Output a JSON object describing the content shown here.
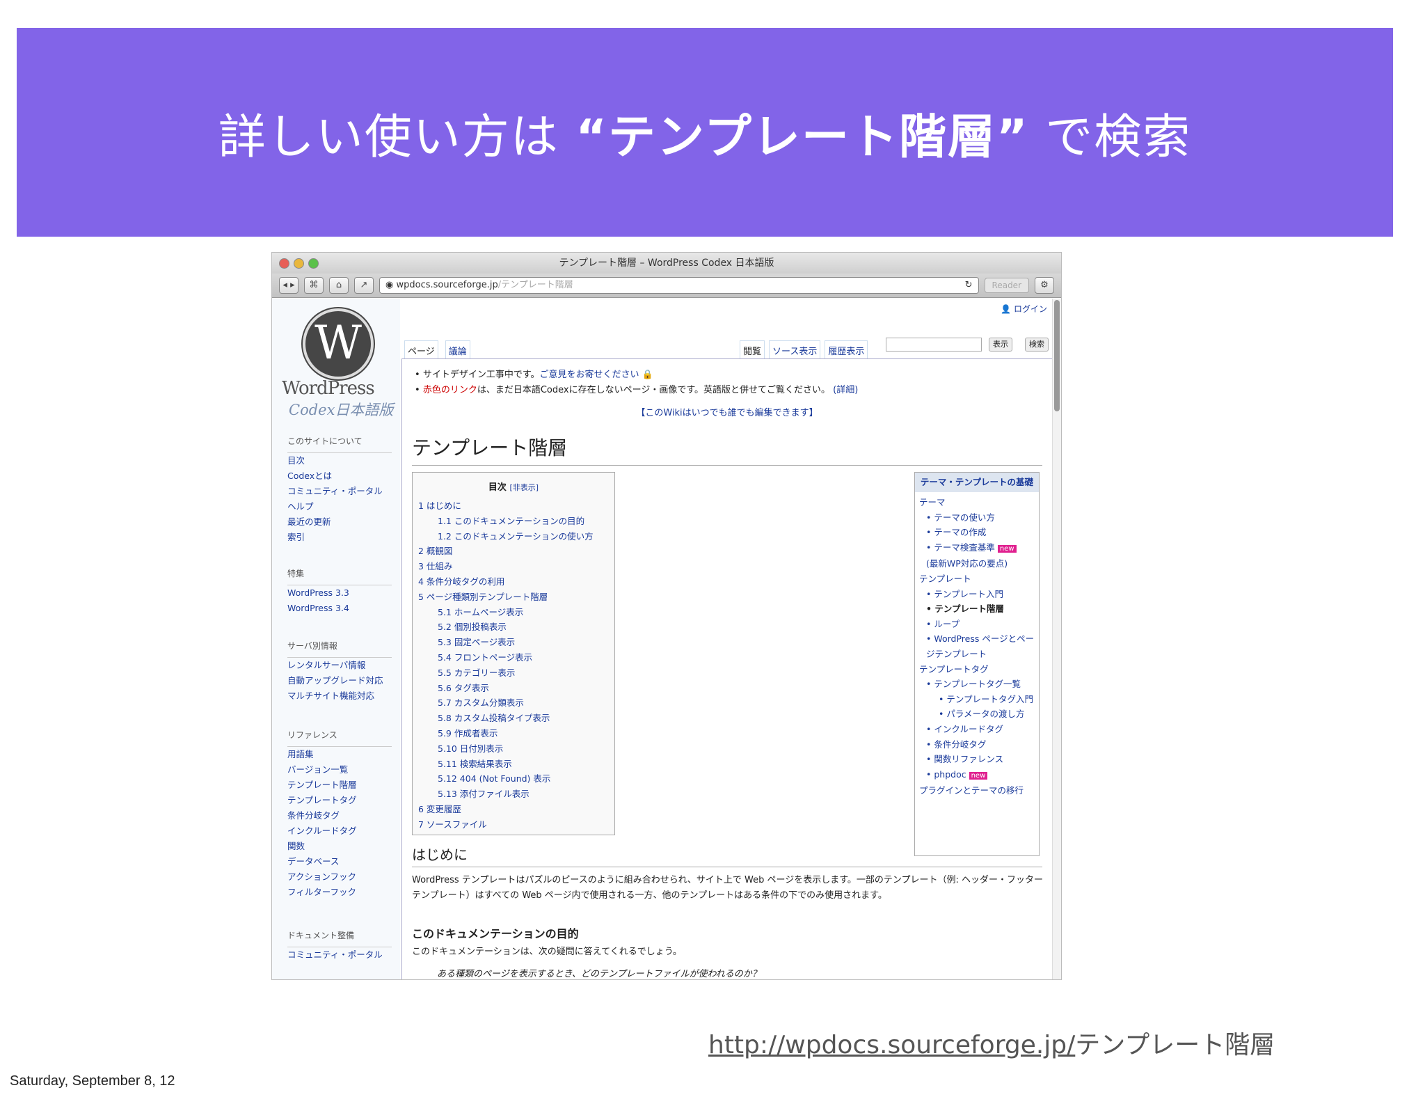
{
  "slide": {
    "title_pre": "詳しい使い方は ",
    "title_bold": "“テンプレート階層”",
    "title_post": " で検索",
    "source_url_link": "http://wpdocs.sourceforge.jp/",
    "source_url_rest": "テンプレート階層",
    "timestamp": "Saturday, September 8, 12",
    "accent_color": "#8264e8"
  },
  "browser": {
    "window_title": "テンプレート階層 – WordPress Codex 日本語版",
    "url_domain": "wpdocs.sourceforge.jp",
    "url_path": "/テンプレート階層",
    "reader_label": "Reader"
  },
  "wiki": {
    "personal_login": "ログイン",
    "logo_letter": "W",
    "logo_text": "WordPress",
    "codex_text": "Codex日本語版",
    "tabs_left": [
      "ページ",
      "議論"
    ],
    "tabs_right": [
      "閲覧",
      "ソース表示",
      "履歴表示"
    ],
    "search_buttons": [
      "表示",
      "検索"
    ],
    "sidebar": [
      {
        "heading": "このサイトについて",
        "items": [
          "目次",
          "Codexとは",
          "コミュニティ・ポータル",
          "ヘルプ",
          "最近の更新",
          "索引"
        ]
      },
      {
        "heading": "特集",
        "items": [
          "WordPress 3.3",
          "WordPress 3.4"
        ]
      },
      {
        "heading": "サーバ別情報",
        "items": [
          "レンタルサーバ情報",
          "自動アップグレード対応",
          "マルチサイト機能対応"
        ]
      },
      {
        "heading": "リファレンス",
        "items": [
          "用語集",
          "バージョン一覧",
          "テンプレート階層",
          "テンプレートタグ",
          "条件分岐タグ",
          "インクルードタグ",
          "関数",
          "データベース",
          "アクションフック",
          "フィルターフック"
        ]
      },
      {
        "heading": "ドキュメント整備",
        "items": [
          "コミュニティ・ポータル"
        ]
      }
    ],
    "notice1_pre": "サイトデザイン工事中です。",
    "notice1_link": "ご意見をお寄せください",
    "notice2_red": "赤色のリンク",
    "notice2_text": "は、まだ日本語Codexに存在しないページ・画像です。英語版と併せてご覧ください。",
    "notice2_link": "(詳細)",
    "notice3": "【このWikiはいつでも誰でも編集できます】",
    "page_title": "テンプレート階層",
    "toc_title": "目次",
    "toc_toggle": "[非表示]",
    "toc": [
      {
        "text": "1 はじめに",
        "sub": false
      },
      {
        "text": "1.1 このドキュメンテーションの目的",
        "sub": true
      },
      {
        "text": "1.2 このドキュメンテーションの使い方",
        "sub": true
      },
      {
        "text": "2 概観図",
        "sub": false
      },
      {
        "text": "3 仕組み",
        "sub": false
      },
      {
        "text": "4 条件分岐タグの利用",
        "sub": false
      },
      {
        "text": "5 ページ種類別テンプレート階層",
        "sub": false
      },
      {
        "text": "5.1 ホームページ表示",
        "sub": true
      },
      {
        "text": "5.2 個別投稿表示",
        "sub": true
      },
      {
        "text": "5.3 固定ページ表示",
        "sub": true
      },
      {
        "text": "5.4 フロントページ表示",
        "sub": true
      },
      {
        "text": "5.5 カテゴリー表示",
        "sub": true
      },
      {
        "text": "5.6 タグ表示",
        "sub": true
      },
      {
        "text": "5.7 カスタム分類表示",
        "sub": true
      },
      {
        "text": "5.8 カスタム投稿タイプ表示",
        "sub": true
      },
      {
        "text": "5.9 作成者表示",
        "sub": true
      },
      {
        "text": "5.10 日付別表示",
        "sub": true
      },
      {
        "text": "5.11 検索結果表示",
        "sub": true
      },
      {
        "text": "5.12 404 (Not Found) 表示",
        "sub": true
      },
      {
        "text": "5.13 添付ファイル表示",
        "sub": true
      },
      {
        "text": "6 変更履歴",
        "sub": false
      },
      {
        "text": "7 ソースファイル",
        "sub": false
      }
    ],
    "infobox_title": "テーマ・テンプレートの基礎",
    "infobox": [
      {
        "text": "テーマ",
        "level": 0,
        "cur": false,
        "new": false
      },
      {
        "text": "• テーマの使い方",
        "level": 1,
        "cur": false,
        "new": false
      },
      {
        "text": "• テーマの作成",
        "level": 1,
        "cur": false,
        "new": false
      },
      {
        "text": "• テーマ検査基準",
        "level": 1,
        "cur": false,
        "new": true
      },
      {
        "text": "(最新WP対応の要点)",
        "level": 1,
        "cur": false,
        "new": false
      },
      {
        "text": "テンプレート",
        "level": 0,
        "cur": false,
        "new": false
      },
      {
        "text": "• テンプレート入門",
        "level": 1,
        "cur": false,
        "new": false
      },
      {
        "text": "• テンプレート階層",
        "level": 1,
        "cur": true,
        "new": false
      },
      {
        "text": "• ループ",
        "level": 1,
        "cur": false,
        "new": false
      },
      {
        "text": "• WordPress ページとページテンプレート",
        "level": 1,
        "cur": false,
        "new": false
      },
      {
        "text": "テンプレートタグ",
        "level": 0,
        "cur": false,
        "new": false
      },
      {
        "text": "• テンプレートタグ一覧",
        "level": 1,
        "cur": false,
        "new": false
      },
      {
        "text": "• テンプレートタグ入門",
        "level": 2,
        "cur": false,
        "new": false
      },
      {
        "text": "• パラメータの渡し方",
        "level": 2,
        "cur": false,
        "new": false
      },
      {
        "text": "• インクルードタグ",
        "level": 1,
        "cur": false,
        "new": false
      },
      {
        "text": "• 条件分岐タグ",
        "level": 1,
        "cur": false,
        "new": false
      },
      {
        "text": "• 関数リファレンス",
        "level": 1,
        "cur": false,
        "new": false
      },
      {
        "text": "• phpdoc",
        "level": 1,
        "cur": false,
        "new": true
      },
      {
        "text": "プラグインとテーマの移行",
        "level": 0,
        "cur": false,
        "new": false
      }
    ],
    "new_label": "new",
    "section_heading": "はじめに",
    "intro_text": "WordPress テンプレートはパズルのピースのように組み合わせられ、サイト上で Web ページを表示します。一部のテンプレート（例: ヘッダー・フッターテンプレート）はすべての Web ページ内で使用される一方、他のテンプレートはある条件の下でのみ使用されます。",
    "purpose_heading": "このドキュメンテーションの目的",
    "purpose_text": "このドキュメンテーションは、次の疑問に答えてくれるでしょう。",
    "purpose_question": "ある種類のページを表示するとき、どのテンプレートファイルが使われるのか？"
  }
}
